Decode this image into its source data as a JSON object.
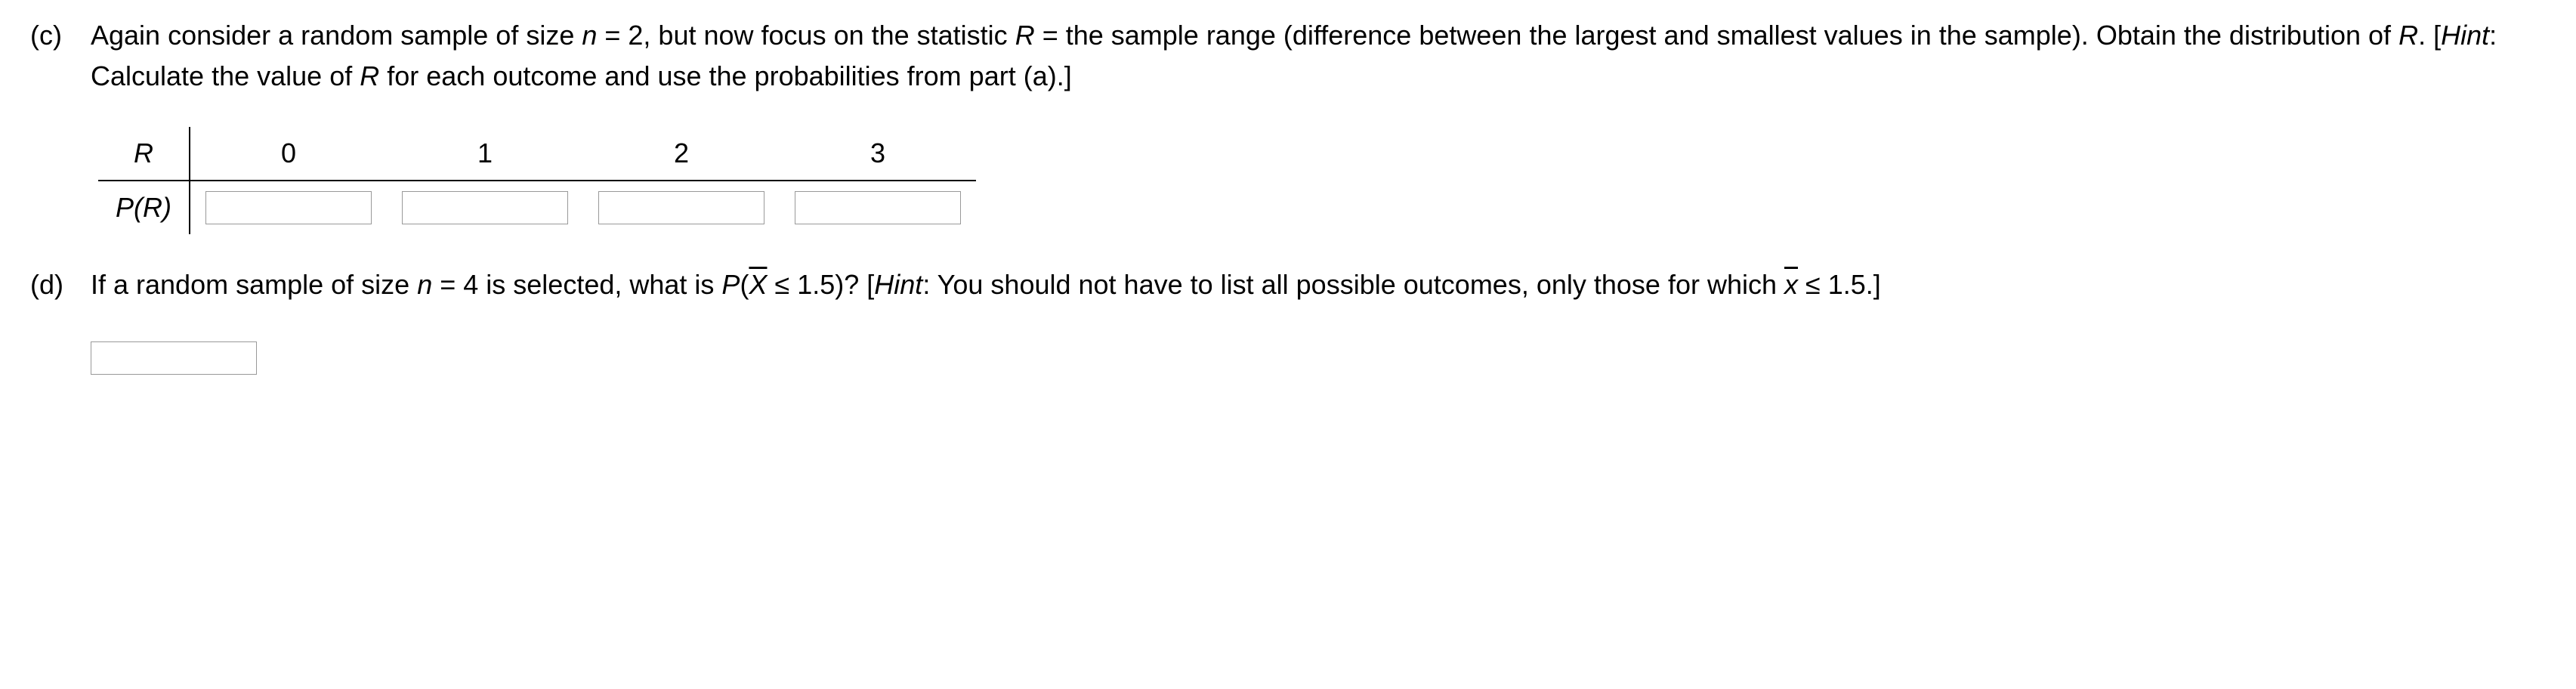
{
  "part_c": {
    "label": "(c)",
    "prompt_1": "Again consider a random sample of size ",
    "var_n": "n",
    "eq1": " = 2, but now focus on the statistic ",
    "var_R": "R",
    "eq2": " = the sample range (difference between the largest and smallest values in the sample). Obtain the distribution of ",
    "var_R2": "R",
    "eq3": ". [",
    "hint_label": "Hint",
    "hint_text": ": Calculate the value of ",
    "var_R3": "R",
    "hint_text2": " for each outcome and use the probabilities from part (a).]",
    "table": {
      "row_label_R": "R",
      "row_label_PR": "P(R)",
      "headers": [
        "0",
        "1",
        "2",
        "3"
      ]
    }
  },
  "part_d": {
    "label": "(d)",
    "prompt_1": "If a random sample of size ",
    "var_n": "n",
    "eq1": " = 4 is selected, what is ",
    "var_P": "P",
    "paren_open": "(",
    "var_Xbar": "X",
    "leq": " ≤ 1.5)? [",
    "hint_label": "Hint",
    "hint_text": ": You should not have to list all possible outcomes, only those for which ",
    "var_xbar": "x",
    "hint_text2": " ≤ 1.5.]"
  }
}
